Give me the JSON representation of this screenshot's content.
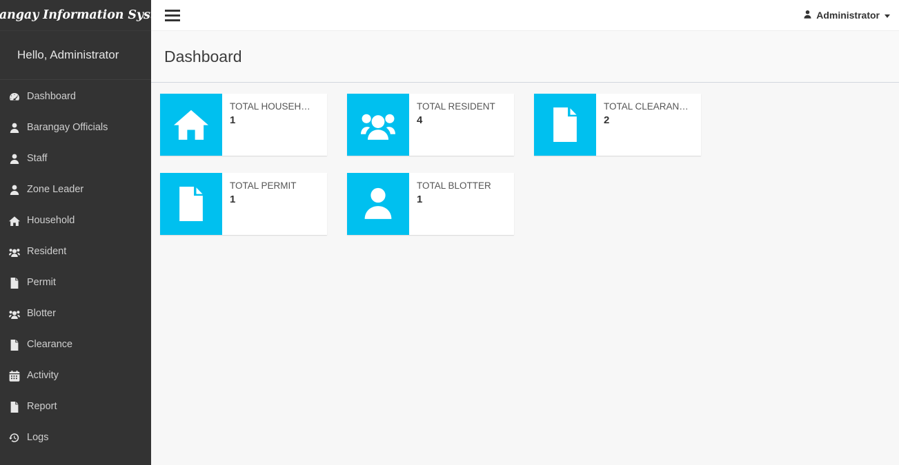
{
  "sidebar": {
    "brand": "Barangay Information System",
    "greeting": "Hello, Administrator",
    "items": [
      {
        "label": "Dashboard",
        "icon": "dashboard-icon"
      },
      {
        "label": "Barangay Officials",
        "icon": "user-icon"
      },
      {
        "label": "Staff",
        "icon": "user-icon"
      },
      {
        "label": "Zone Leader",
        "icon": "user-icon"
      },
      {
        "label": "Household",
        "icon": "home-icon"
      },
      {
        "label": "Resident",
        "icon": "users-icon"
      },
      {
        "label": "Permit",
        "icon": "file-icon"
      },
      {
        "label": "Blotter",
        "icon": "users-icon"
      },
      {
        "label": "Clearance",
        "icon": "file-icon"
      },
      {
        "label": "Activity",
        "icon": "calendar-icon"
      },
      {
        "label": "Report",
        "icon": "file-icon"
      },
      {
        "label": "Logs",
        "icon": "history-icon"
      }
    ]
  },
  "navbar": {
    "menu_toggle": "hamburger-icon",
    "user_label": "Administrator",
    "user_icon": "user-icon",
    "caret": "caret-down-icon"
  },
  "header": {
    "page_title": "Dashboard"
  },
  "colors": {
    "accent": "#00c0ef",
    "sidebar_bg": "#333333",
    "content_bg": "#f7f7f7",
    "card_bg": "#ffffff"
  },
  "cards": [
    {
      "label": "TOTAL HOUSEH…",
      "value": "1",
      "icon": "home-icon"
    },
    {
      "label": "TOTAL RESIDENT",
      "value": "4",
      "icon": "users-icon"
    },
    {
      "label": "TOTAL CLEARAN…",
      "value": "2",
      "icon": "file-icon"
    },
    {
      "label": "TOTAL PERMIT",
      "value": "1",
      "icon": "file-icon"
    },
    {
      "label": "TOTAL BLOTTER",
      "value": "1",
      "icon": "user-icon"
    }
  ]
}
